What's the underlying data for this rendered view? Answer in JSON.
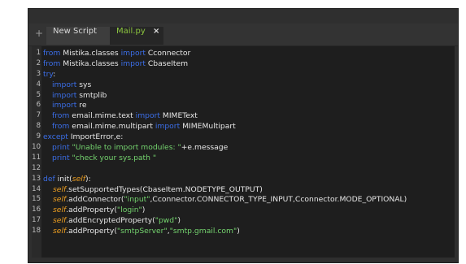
{
  "tabs": {
    "add_label": "+",
    "items": [
      {
        "label": "New Script"
      },
      {
        "label": "Mail.py",
        "close": "×"
      }
    ]
  },
  "editor": {
    "line_numbers": [
      "1",
      "2",
      "3",
      "4",
      "5",
      "6",
      "7",
      "8",
      "9",
      "10",
      "11",
      "12",
      "13",
      "14",
      "15",
      "16",
      "17",
      "18"
    ],
    "lines": [
      {
        "k1": "from",
        "t1": " Mistika.classes ",
        "k2": "import",
        "t2": " Cconnector"
      },
      {
        "k1": "from",
        "t1": " Mistika.classes ",
        "k2": "import",
        "t2": " CbaseItem"
      },
      {
        "k1": "try",
        "t1": ":"
      },
      {
        "k1": "import",
        "t1": " sys"
      },
      {
        "k1": "import",
        "t1": " smtplib"
      },
      {
        "k1": "import",
        "t1": " re"
      },
      {
        "k1": "from",
        "t1": " email.mime.text ",
        "k2": "import",
        "t2": " MIMEText"
      },
      {
        "k1": "from",
        "t1": " email.mime.multipart ",
        "k2": "import",
        "t2": " MIMEMultipart"
      },
      {
        "k1": "except",
        "t1": " ImportError,e:"
      },
      {
        "k1": "print",
        "s1": " \"Unable to import modules: \"",
        "t1": "+e.message"
      },
      {
        "k1": "print",
        "s1": " \"check your sys.path \""
      },
      {
        "t1": ""
      },
      {
        "k1": "def",
        "t1": " init(",
        "self": "self",
        "t2": "):"
      },
      {
        "self": "self",
        "t1": ".setSupportedTypes(CbaseItem.NODETYPE_OUTPUT)"
      },
      {
        "self": "self",
        "t1": ".addConnector(",
        "s1": "\"input\"",
        "t2": ",Cconnector.CONNECTOR_TYPE_INPUT,Cconnector.MODE_OPTIONAL)"
      },
      {
        "self": "self",
        "t1": ".addProperty(",
        "s1": "\"login\"",
        "t2": ")"
      },
      {
        "self": "self",
        "t1": ".addEncryptedProperty(",
        "s1": "\"pwd\"",
        "t2": ")"
      },
      {
        "self": "self",
        "t1": ".addProperty(",
        "s1": "\"smtpServer\"",
        "t2": ",",
        "s2": "\"smtp.gmail.com\"",
        "t3": ")"
      }
    ]
  },
  "colors": {
    "keyword": "#3b6ee8",
    "self": "#f0a020",
    "string": "#74d36e",
    "active_tab_text": "#8cc63f",
    "editor_bg": "#1e1e1e"
  }
}
